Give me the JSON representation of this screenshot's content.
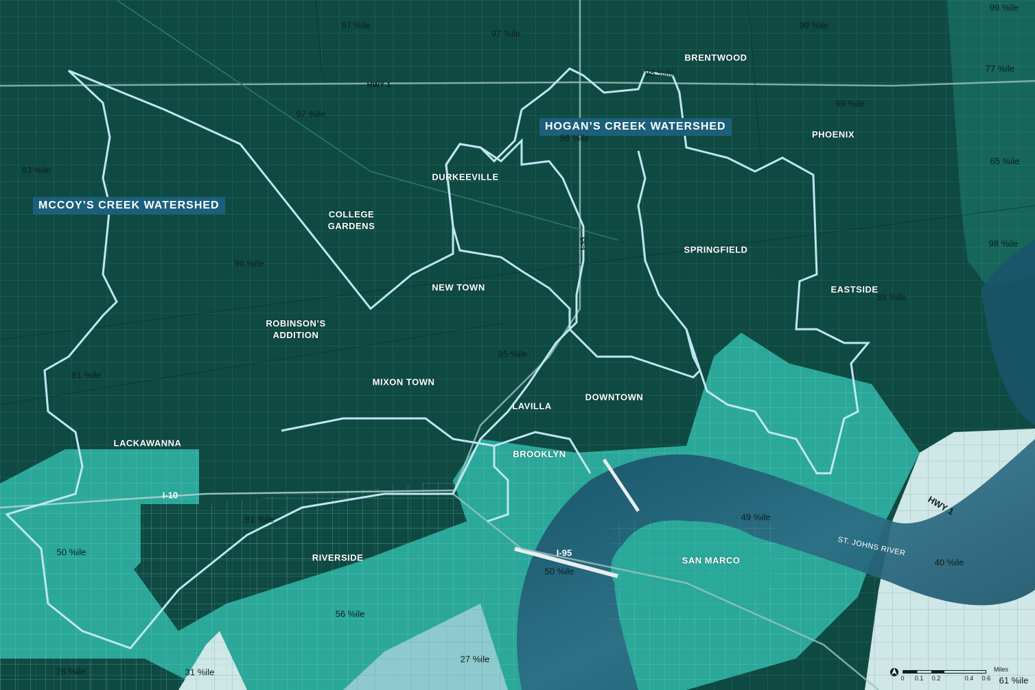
{
  "watersheds": {
    "mccoy": "MCCOY’S CREEK WATERSHED",
    "hogan": "HOGAN’S CREEK WATERSHED"
  },
  "neighborhoods": {
    "brentwood": "BRENTWOOD",
    "phoenix": "PHOENIX",
    "durkeeville": "DURKEEVILLE",
    "college_gardens": "COLLEGE GARDENS",
    "springfield": "SPRINGFIELD",
    "eastside": "EASTSIDE",
    "new_town": "NEW TOWN",
    "robinsons_addition": "ROBINSON’S ADDITION",
    "mixon_town": "MIXON TOWN",
    "lavilla": "LAVILLA",
    "downtown": "DOWNTOWN",
    "lackawanna": "LACKAWANNA",
    "brooklyn": "BROOKLYN",
    "riverside": "RIVERSIDE",
    "san_marco": "SAN MARCO"
  },
  "percentiles": {
    "p1": "97 %ile",
    "p2": "97 %ile",
    "p3": "99 %ile",
    "p4": "99 %ile",
    "p5": "98 %ile",
    "p6": "77 %ile",
    "p7": "97 %ile",
    "p8": "99 %ile",
    "p9": "98 %ile",
    "p10": "83 %ile",
    "p11": "65 %ile",
    "p12": "98 %ile",
    "p13": "96 %ile",
    "p14": "88 %ile",
    "p15": "95 %ile",
    "p16": "81 %ile",
    "p17": "91 %ile",
    "p18": "50 %ile",
    "p19": "49 %ile",
    "p20": "40 %ile",
    "p21": "50 %ile",
    "p22": "56 %ile",
    "p23": "76 %ile",
    "p24": "31 %ile",
    "p25": "27 %ile",
    "p26": "61 %ile"
  },
  "highways": {
    "hwy1_north": "HWY 1",
    "i95_north": "I-95",
    "i10": "I-10",
    "i95_south": "I-95",
    "hwy1_east": "HWY 1"
  },
  "water": {
    "river": "ST. JOHNS RIVER"
  },
  "scale": {
    "ticks": [
      "0",
      "0.1",
      "0.2",
      "0.4",
      "0.6"
    ],
    "unit": "Miles"
  },
  "colors": {
    "high_percentile": "#0f4a42",
    "mid_percentile": "#17665c",
    "low_percentile": "#2aa89a",
    "lowest_percentile": "#cfe7e6",
    "river": "#1d5c73",
    "watershed_outline": "#bfe6f2"
  }
}
